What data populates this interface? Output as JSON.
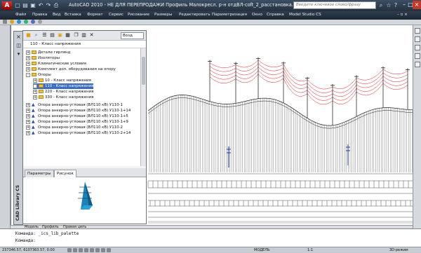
{
  "window": {
    "app_icon": "A",
    "title": "AutoCAD 2010 - НЕ ДЛЯ ПЕРЕПРОДАЖИ   Профиль Малокресл. р-н отдВЛ-сoft_2_расстановка.dwg",
    "search_placeholder": "Введите ключевое слово/фразу"
  },
  "menu": [
    "Файл",
    "Правка",
    "Вид",
    "Вставка",
    "Формат",
    "Сервис",
    "Рисование",
    "Размеры",
    "Редактировать",
    "Параметризация",
    "Окно",
    "Справка",
    "Model Studio CS"
  ],
  "palette": {
    "side_title": "CAD Library CS",
    "view_dropdown": "Возд",
    "path": "110 - Класс напряжения",
    "tree": [
      {
        "label": "Детали гирлянд",
        "level": 1,
        "expand": "+",
        "icon": "folder"
      },
      {
        "label": "Изоляторы",
        "level": 1,
        "expand": "+",
        "icon": "folder"
      },
      {
        "label": "Климатические условия",
        "level": 1,
        "expand": "+",
        "icon": "folder"
      },
      {
        "label": "Комплект доп. оборудования на опору",
        "level": 1,
        "expand": "+",
        "icon": "folder"
      },
      {
        "label": "Опоры",
        "level": 1,
        "expand": "-",
        "icon": "folder"
      },
      {
        "label": "10 - Класс напряжения",
        "level": 2,
        "expand": "+",
        "icon": "folder"
      },
      {
        "label": "110 - Класс напряжения",
        "level": 2,
        "expand": "+",
        "icon": "folder",
        "selected": true
      },
      {
        "label": "220 - Класс напряжения",
        "level": 2,
        "expand": "+",
        "icon": "folder"
      },
      {
        "label": "330 - Класс напряжения",
        "level": 2,
        "expand": "+",
        "icon": "folder"
      }
    ],
    "items": [
      "Опора анкерно-угловая (ВЛ110 кВ) У110-1",
      "Опора анкерно-угловая (ВЛ110 кВ) У110-1+14",
      "Опора анкерно-угловая (ВЛ110 кВ) У110-1+5",
      "Опора анкерно-угловая (ВЛ110 кВ) У110-1+9",
      "Опора анкерно-угловая (ВЛ110 кВ) У110-2",
      "Опора анкерно-угловая (ВЛ110 кВ) У110-2+14"
    ],
    "tabs": [
      {
        "label": "Параметры",
        "active": false
      },
      {
        "label": "Рисунок",
        "active": true
      }
    ]
  },
  "drawing": {
    "model_tabs": [
      "Модель",
      "Профиль",
      "Правая цепь"
    ]
  },
  "command": {
    "line1": "Команда: _ics_lib_palette",
    "line2": "Команда:"
  },
  "status": {
    "coords": "237346.57, 6107363.57, 0.00",
    "model_label": "МОДЕЛЬ",
    "scale": "1:1",
    "workspace": "3D-режим"
  },
  "colors": {
    "accent": "#3a6cc0",
    "wire": "#e2232a"
  }
}
